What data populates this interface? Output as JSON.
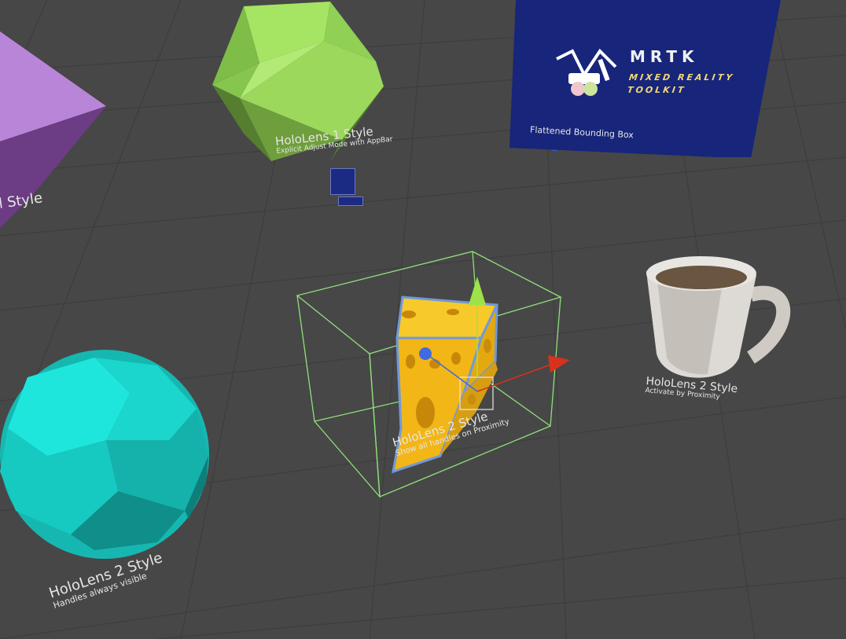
{
  "scene": {
    "background_color": "#474747",
    "grid_color": "#3c3c3c"
  },
  "objects": {
    "purple_octahedron": {
      "label": "l Style",
      "color": "#b47ad4"
    },
    "green_icosahedron": {
      "title": "HoloLens 1 Style",
      "subtitle": "Explicit Adjust Mode with AppBar",
      "color": "#8fd15a"
    },
    "mrtk_panel": {
      "title": "MRTK",
      "line1": "MIXED REALITY",
      "line2": "TOOLKIT",
      "label": "Flattened Bounding Box",
      "color": "#17257a"
    },
    "cheese": {
      "title": "HoloLens 2 Style",
      "subtitle": "Show all handles on Proximity",
      "color": "#f2b617"
    },
    "mug": {
      "title": "HoloLens 2 Style",
      "subtitle": "Activate by Proximity",
      "color": "#e2e0dc"
    },
    "teal_sphere": {
      "title": "HoloLens 2 Style",
      "subtitle": "Handles always visible",
      "color": "#19d8d0"
    }
  },
  "gizmo": {
    "x_axis_color": "#d8321c",
    "y_axis_color": "#9ee24a",
    "z_axis_color": "#3f6ae0",
    "bounds_color": "#8fe07a"
  }
}
